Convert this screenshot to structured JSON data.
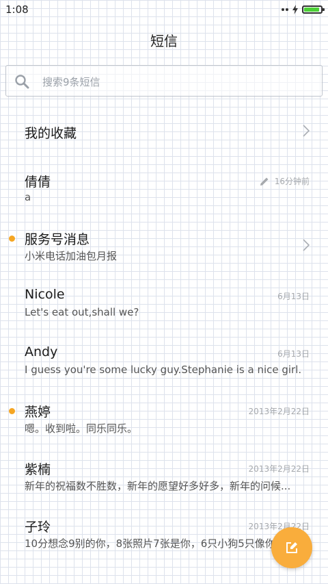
{
  "status_bar": {
    "time": "1:08",
    "battery_level": 0.9,
    "battery_color": "#4cd137"
  },
  "header": {
    "title": "短信"
  },
  "search": {
    "placeholder": "搜索9条短信",
    "icon": "search-icon"
  },
  "favorites": {
    "label": "我的收藏",
    "icon": "chevron-right-icon"
  },
  "conversations": [
    {
      "name": "倩倩",
      "preview": "a",
      "time": "16分钟前",
      "draft": true,
      "unread": false,
      "chevron": false
    },
    {
      "name": "服务号消息",
      "preview": "小米电话加油包月报",
      "time": "",
      "draft": false,
      "unread": true,
      "chevron": true
    },
    {
      "name": "Nicole",
      "preview": "Let's eat out,shall we?",
      "time": "6月13日",
      "draft": false,
      "unread": false,
      "chevron": false
    },
    {
      "name": "Andy",
      "preview": "I guess you're some lucky guy.Stephanie is a nice girl.",
      "time": "6月13日",
      "draft": false,
      "unread": false,
      "chevron": false
    },
    {
      "name": "燕婷",
      "preview": "嗯。收到啦。同乐同乐。",
      "time": "2013年2月22日",
      "draft": false,
      "unread": true,
      "chevron": false
    },
    {
      "name": "紫楠",
      "preview": "新年的祝福数不胜数，新年的愿望好多好多，新年的问候...",
      "time": "2013年2月22日",
      "draft": false,
      "unread": false,
      "chevron": false
    },
    {
      "name": "子玲",
      "preview": "10分想念9别的你，8张照片7张是你，6只小狗5只像你",
      "time": "2013年2月22日",
      "draft": false,
      "unread": false,
      "chevron": false
    }
  ],
  "fab": {
    "icon": "compose-icon",
    "color": "#f9ad3c"
  },
  "colors": {
    "accent": "#f5a623",
    "unread_dot": "#f5a623",
    "date_text": "#a6a9ad"
  }
}
